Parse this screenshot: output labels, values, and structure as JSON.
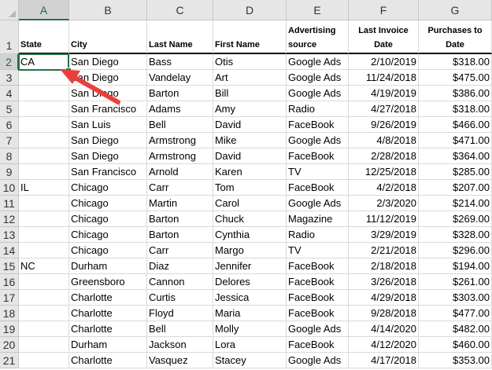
{
  "columns": [
    "A",
    "B",
    "C",
    "D",
    "E",
    "F",
    "G"
  ],
  "headers": [
    "State",
    "City",
    "Last Name",
    "First Name",
    "Advertising source",
    "Last Invoice Date",
    "Purchases to Date"
  ],
  "rows": [
    [
      "CA",
      "San Diego",
      "Bass",
      "Otis",
      "Google Ads",
      "2/10/2019",
      "$318.00"
    ],
    [
      "",
      "San Diego",
      "Vandelay",
      "Art",
      "Google Ads",
      "11/24/2018",
      "$475.00"
    ],
    [
      "",
      "San Diego",
      "Barton",
      "Bill",
      "Google Ads",
      "4/19/2019",
      "$386.00"
    ],
    [
      "",
      "San Francisco",
      "Adams",
      "Amy",
      "Radio",
      "4/27/2018",
      "$318.00"
    ],
    [
      "",
      "San Luis",
      "Bell",
      "David",
      "FaceBook",
      "9/26/2019",
      "$466.00"
    ],
    [
      "",
      "San Diego",
      "Armstrong",
      "Mike",
      "Google Ads",
      "4/8/2018",
      "$471.00"
    ],
    [
      "",
      "San Diego",
      "Armstrong",
      "David",
      "FaceBook",
      "2/28/2018",
      "$364.00"
    ],
    [
      "",
      "San Francisco",
      "Arnold",
      "Karen",
      "TV",
      "12/25/2018",
      "$285.00"
    ],
    [
      "IL",
      "Chicago",
      "Carr",
      "Tom",
      "FaceBook",
      "4/2/2018",
      "$207.00"
    ],
    [
      "",
      "Chicago",
      "Martin",
      "Carol",
      "Google Ads",
      "2/3/2020",
      "$214.00"
    ],
    [
      "",
      "Chicago",
      "Barton",
      "Chuck",
      "Magazine",
      "11/12/2019",
      "$269.00"
    ],
    [
      "",
      "Chicago",
      "Barton",
      "Cynthia",
      "Radio",
      "3/29/2019",
      "$328.00"
    ],
    [
      "",
      "Chicago",
      "Carr",
      "Margo",
      "TV",
      "2/21/2018",
      "$296.00"
    ],
    [
      "NC",
      "Durham",
      "Diaz",
      "Jennifer",
      "FaceBook",
      "2/18/2018",
      "$194.00"
    ],
    [
      "",
      "Greensboro",
      "Cannon",
      "Delores",
      "FaceBook",
      "3/26/2018",
      "$261.00"
    ],
    [
      "",
      "Charlotte",
      "Curtis",
      "Jessica",
      "FaceBook",
      "4/29/2018",
      "$303.00"
    ],
    [
      "",
      "Charlotte",
      "Floyd",
      "Maria",
      "FaceBook",
      "9/28/2018",
      "$477.00"
    ],
    [
      "",
      "Charlotte",
      "Bell",
      "Molly",
      "Google Ads",
      "4/14/2020",
      "$482.00"
    ],
    [
      "",
      "Durham",
      "Jackson",
      "Lora",
      "FaceBook",
      "4/12/2020",
      "$460.00"
    ],
    [
      "",
      "Charlotte",
      "Vasquez",
      "Stacey",
      "Google Ads",
      "4/17/2018",
      "$353.00"
    ]
  ],
  "selected_cell": "A2",
  "colors": {
    "selection": "#217346",
    "arrow": "#e8413c"
  }
}
